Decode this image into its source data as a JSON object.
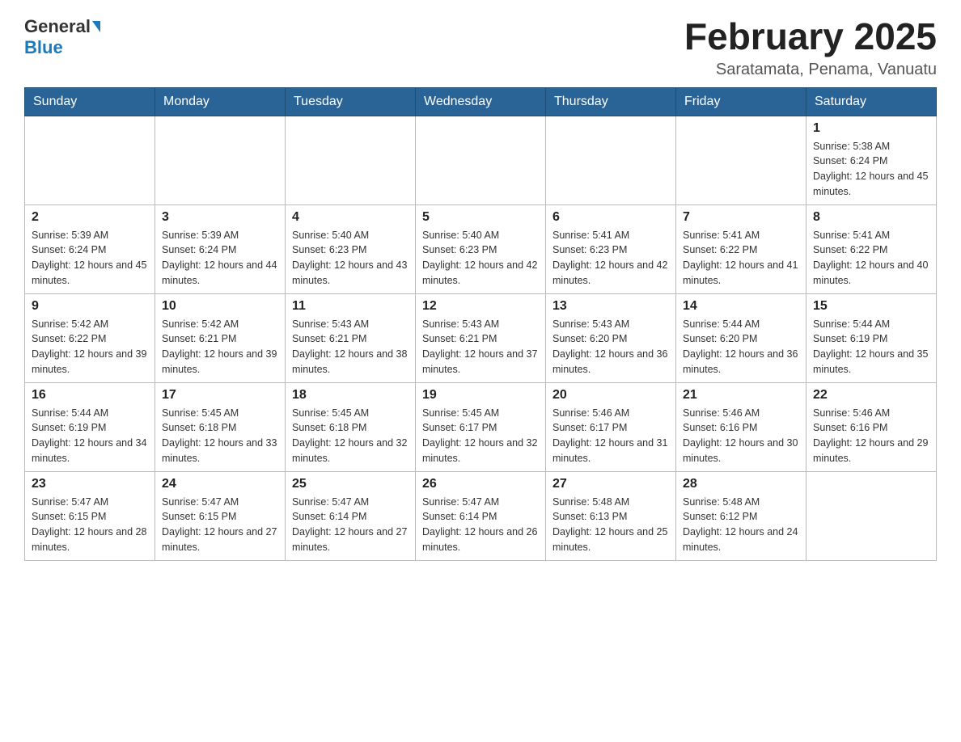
{
  "logo": {
    "general": "General",
    "blue": "Blue",
    "arrow": "▲"
  },
  "header": {
    "title": "February 2025",
    "subtitle": "Saratamata, Penama, Vanuatu"
  },
  "weekdays": [
    "Sunday",
    "Monday",
    "Tuesday",
    "Wednesday",
    "Thursday",
    "Friday",
    "Saturday"
  ],
  "weeks": [
    [
      {
        "day": "",
        "info": ""
      },
      {
        "day": "",
        "info": ""
      },
      {
        "day": "",
        "info": ""
      },
      {
        "day": "",
        "info": ""
      },
      {
        "day": "",
        "info": ""
      },
      {
        "day": "",
        "info": ""
      },
      {
        "day": "1",
        "info": "Sunrise: 5:38 AM\nSunset: 6:24 PM\nDaylight: 12 hours and 45 minutes."
      }
    ],
    [
      {
        "day": "2",
        "info": "Sunrise: 5:39 AM\nSunset: 6:24 PM\nDaylight: 12 hours and 45 minutes."
      },
      {
        "day": "3",
        "info": "Sunrise: 5:39 AM\nSunset: 6:24 PM\nDaylight: 12 hours and 44 minutes."
      },
      {
        "day": "4",
        "info": "Sunrise: 5:40 AM\nSunset: 6:23 PM\nDaylight: 12 hours and 43 minutes."
      },
      {
        "day": "5",
        "info": "Sunrise: 5:40 AM\nSunset: 6:23 PM\nDaylight: 12 hours and 42 minutes."
      },
      {
        "day": "6",
        "info": "Sunrise: 5:41 AM\nSunset: 6:23 PM\nDaylight: 12 hours and 42 minutes."
      },
      {
        "day": "7",
        "info": "Sunrise: 5:41 AM\nSunset: 6:22 PM\nDaylight: 12 hours and 41 minutes."
      },
      {
        "day": "8",
        "info": "Sunrise: 5:41 AM\nSunset: 6:22 PM\nDaylight: 12 hours and 40 minutes."
      }
    ],
    [
      {
        "day": "9",
        "info": "Sunrise: 5:42 AM\nSunset: 6:22 PM\nDaylight: 12 hours and 39 minutes."
      },
      {
        "day": "10",
        "info": "Sunrise: 5:42 AM\nSunset: 6:21 PM\nDaylight: 12 hours and 39 minutes."
      },
      {
        "day": "11",
        "info": "Sunrise: 5:43 AM\nSunset: 6:21 PM\nDaylight: 12 hours and 38 minutes."
      },
      {
        "day": "12",
        "info": "Sunrise: 5:43 AM\nSunset: 6:21 PM\nDaylight: 12 hours and 37 minutes."
      },
      {
        "day": "13",
        "info": "Sunrise: 5:43 AM\nSunset: 6:20 PM\nDaylight: 12 hours and 36 minutes."
      },
      {
        "day": "14",
        "info": "Sunrise: 5:44 AM\nSunset: 6:20 PM\nDaylight: 12 hours and 36 minutes."
      },
      {
        "day": "15",
        "info": "Sunrise: 5:44 AM\nSunset: 6:19 PM\nDaylight: 12 hours and 35 minutes."
      }
    ],
    [
      {
        "day": "16",
        "info": "Sunrise: 5:44 AM\nSunset: 6:19 PM\nDaylight: 12 hours and 34 minutes."
      },
      {
        "day": "17",
        "info": "Sunrise: 5:45 AM\nSunset: 6:18 PM\nDaylight: 12 hours and 33 minutes."
      },
      {
        "day": "18",
        "info": "Sunrise: 5:45 AM\nSunset: 6:18 PM\nDaylight: 12 hours and 32 minutes."
      },
      {
        "day": "19",
        "info": "Sunrise: 5:45 AM\nSunset: 6:17 PM\nDaylight: 12 hours and 32 minutes."
      },
      {
        "day": "20",
        "info": "Sunrise: 5:46 AM\nSunset: 6:17 PM\nDaylight: 12 hours and 31 minutes."
      },
      {
        "day": "21",
        "info": "Sunrise: 5:46 AM\nSunset: 6:16 PM\nDaylight: 12 hours and 30 minutes."
      },
      {
        "day": "22",
        "info": "Sunrise: 5:46 AM\nSunset: 6:16 PM\nDaylight: 12 hours and 29 minutes."
      }
    ],
    [
      {
        "day": "23",
        "info": "Sunrise: 5:47 AM\nSunset: 6:15 PM\nDaylight: 12 hours and 28 minutes."
      },
      {
        "day": "24",
        "info": "Sunrise: 5:47 AM\nSunset: 6:15 PM\nDaylight: 12 hours and 27 minutes."
      },
      {
        "day": "25",
        "info": "Sunrise: 5:47 AM\nSunset: 6:14 PM\nDaylight: 12 hours and 27 minutes."
      },
      {
        "day": "26",
        "info": "Sunrise: 5:47 AM\nSunset: 6:14 PM\nDaylight: 12 hours and 26 minutes."
      },
      {
        "day": "27",
        "info": "Sunrise: 5:48 AM\nSunset: 6:13 PM\nDaylight: 12 hours and 25 minutes."
      },
      {
        "day": "28",
        "info": "Sunrise: 5:48 AM\nSunset: 6:12 PM\nDaylight: 12 hours and 24 minutes."
      },
      {
        "day": "",
        "info": ""
      }
    ]
  ]
}
